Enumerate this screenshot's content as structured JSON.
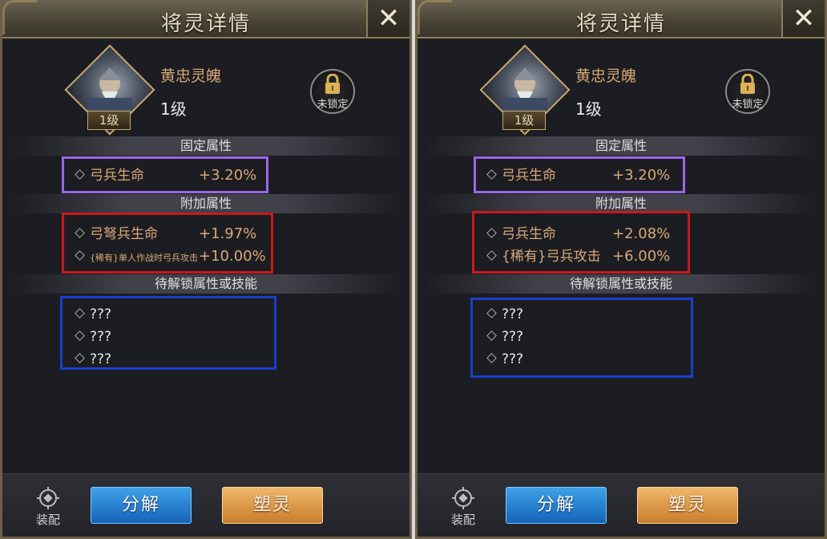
{
  "panels": [
    {
      "title": "将灵详情",
      "hero": {
        "name": "黄忠灵魄",
        "level": "1级",
        "badge": "1级"
      },
      "lock_label": "未锁定",
      "fixed": {
        "header": "固定属性",
        "rows": [
          {
            "name": "弓兵生命",
            "value": "+3.20%"
          }
        ]
      },
      "extra": {
        "header": "附加属性",
        "rows": [
          {
            "name": "弓弩兵生命",
            "value": "+1.97%"
          },
          {
            "name": "{稀有}单人作战时弓兵攻击",
            "value": "+10.00%"
          }
        ]
      },
      "locked": {
        "header": "待解锁属性或技能",
        "rows": [
          "???",
          "???",
          "???"
        ]
      },
      "footer": {
        "equip_label": "装配",
        "decompose_label": "分解",
        "reshape_label": "塑灵"
      }
    },
    {
      "title": "将灵详情",
      "hero": {
        "name": "黄忠灵魄",
        "level": "1级",
        "badge": "1级"
      },
      "lock_label": "未锁定",
      "fixed": {
        "header": "固定属性",
        "rows": [
          {
            "name": "弓兵生命",
            "value": "+3.20%"
          }
        ]
      },
      "extra": {
        "header": "附加属性",
        "rows": [
          {
            "name": "弓兵生命",
            "value": "+2.08%"
          },
          {
            "name": "{稀有}弓兵攻击",
            "value": "+6.00%"
          }
        ]
      },
      "locked": {
        "header": "待解锁属性或技能",
        "rows": [
          "???",
          "???",
          "???"
        ]
      },
      "footer": {
        "equip_label": "装配",
        "decompose_label": "分解",
        "reshape_label": "塑灵"
      }
    }
  ],
  "colors": {
    "attr_text": "#d9a877",
    "highlight_fixed": "#9c66e6",
    "highlight_extra": "#c81a1a",
    "highlight_locked": "#1840c8",
    "button_blue": "#1663b8",
    "button_gold": "#c97d2c"
  },
  "icons": {
    "close": "close-icon",
    "lock": "lock-icon",
    "equip": "gear-icon"
  }
}
